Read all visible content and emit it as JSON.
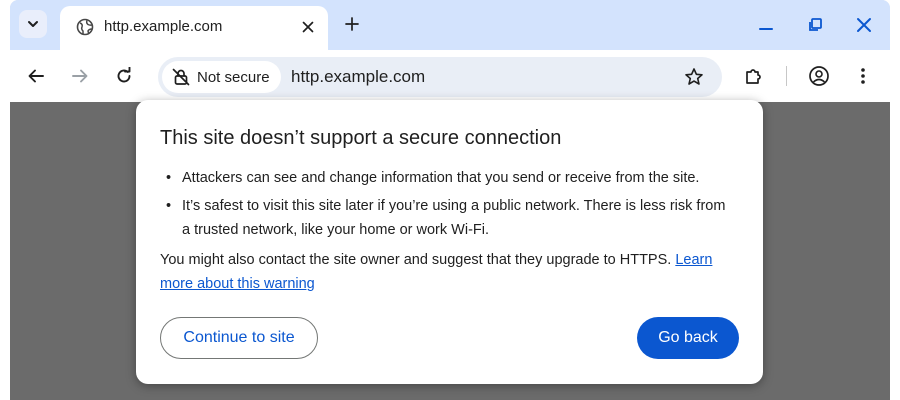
{
  "tab": {
    "title": "http.example.com",
    "favicon": "globe-icon"
  },
  "toolbar": {
    "security_chip_label": "Not secure",
    "security_icon": "not-secure-lock-icon",
    "url": "http.example.com"
  },
  "dialog": {
    "title": "This site doesn’t support a secure connection",
    "bullets": [
      "Attackers can see and change information that you send or receive from the site.",
      "It’s safest to visit this site later if you’re using a public network. There is less risk from a trusted network, like your home or work Wi-Fi."
    ],
    "paragraph": "You might also contact the site owner and suggest that they upgrade to HTTPS.",
    "learn_more_link": "Learn more about this warning",
    "continue_button": "Continue to site",
    "back_button": "Go back"
  },
  "colors": {
    "accent": "#0b57d0",
    "tabstrip": "#d3e3fd",
    "omnibox": "#e9eef6",
    "page_dim": "#6b6b6b"
  }
}
